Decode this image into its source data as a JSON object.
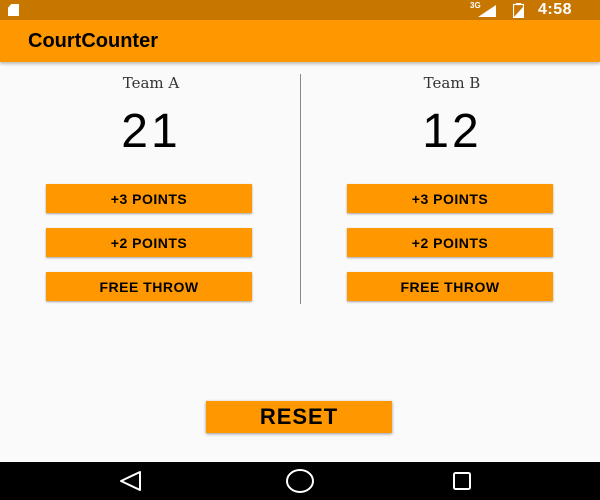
{
  "status_bar": {
    "network": "3G",
    "time": "4:58",
    "icons": [
      "sd-card-icon",
      "signal-icon",
      "battery-icon"
    ]
  },
  "app_bar": {
    "title": "CourtCounter",
    "color": "#ff9800"
  },
  "team_a": {
    "name": "Team A",
    "score": "21",
    "buttons": [
      "+3 POINTS",
      "+2 POINTS",
      "FREE THROW"
    ]
  },
  "team_b": {
    "name": "Team B",
    "score": "12",
    "buttons": [
      "+3 POINTS",
      "+2 POINTS",
      "FREE THROW"
    ]
  },
  "reset_label": "RESET",
  "nav_bar": {
    "icons": [
      "back-icon",
      "home-icon",
      "recent-apps-icon"
    ]
  },
  "colors": {
    "accent": "#ff9800",
    "status_bar": "#c77700",
    "background": "#fafafa",
    "nav_bar": "#000000"
  }
}
